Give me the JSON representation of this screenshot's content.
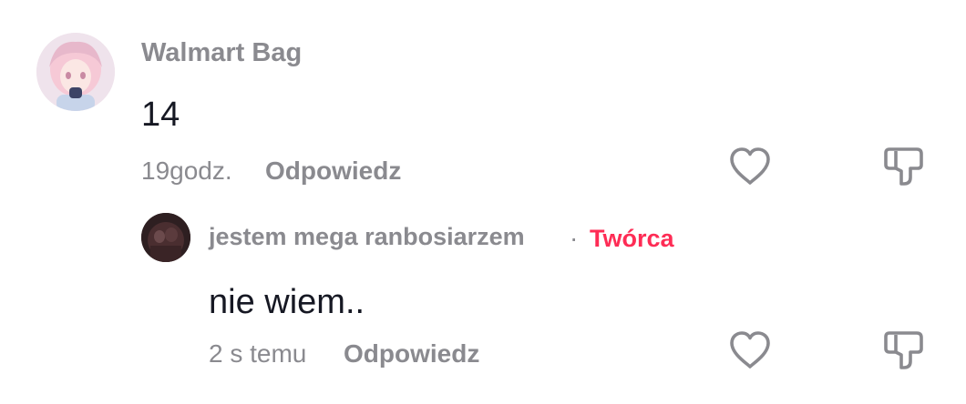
{
  "comment": {
    "username": "Walmart Bag",
    "text": "14",
    "time": "19godz.",
    "reply_label": "Odpowiedz",
    "like_icon": "heart-outline-icon",
    "dislike_icon": "thumbs-down-icon"
  },
  "reply": {
    "username": "jestem mega ranbosiarzem",
    "separator": "·",
    "badge": "Twórca",
    "text": "nie wiem..",
    "time": "2 s temu",
    "reply_label": "Odpowiedz",
    "like_icon": "heart-outline-icon",
    "dislike_icon": "thumbs-down-icon"
  },
  "colors": {
    "creator_badge": "#fe2c55",
    "secondary_text": "#8a8a8f",
    "primary_text": "#161823",
    "icon": "#8a8a8f"
  }
}
